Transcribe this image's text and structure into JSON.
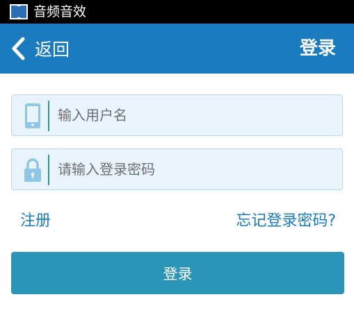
{
  "status_bar": {
    "app_icon": "dolby-logo-icon",
    "app_name": "音频音效"
  },
  "header": {
    "back_icon": "chevron-left-icon",
    "back_label": "返回",
    "title": "登录",
    "background_color": "#1a7bbf"
  },
  "form": {
    "username": {
      "icon": "phone-icon",
      "placeholder": "输入用户名",
      "value": ""
    },
    "password": {
      "icon": "lock-icon",
      "placeholder": "请输入登录密码",
      "value": ""
    },
    "register_link": "注册",
    "forgot_password_link": "忘记登录密码?",
    "login_button": "登录",
    "login_button_color": "#2b95b8"
  }
}
